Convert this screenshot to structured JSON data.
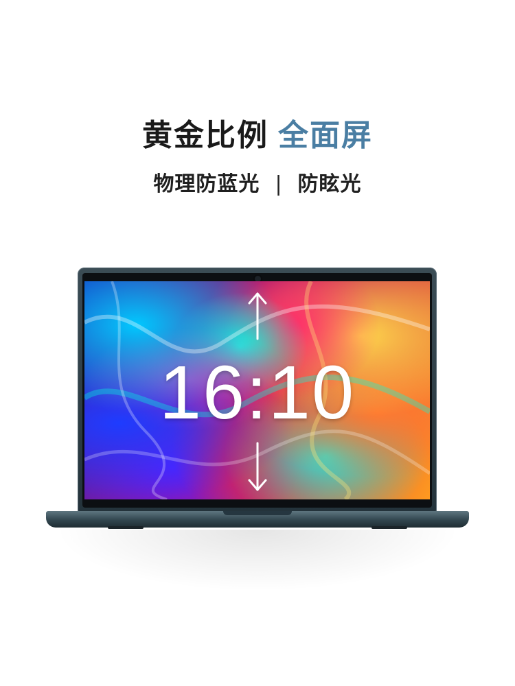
{
  "headline": {
    "part1": "黄金比例",
    "part2": "全面屏",
    "accent_color": "#4a7ea3"
  },
  "subline": {
    "left": "物理防蓝光",
    "separator": "|",
    "right": "防眩光"
  },
  "screen": {
    "ratio_text": "16:10"
  },
  "icons": {
    "up": "arrow-up-icon",
    "down": "arrow-down-icon",
    "camera": "webcam-icon"
  }
}
